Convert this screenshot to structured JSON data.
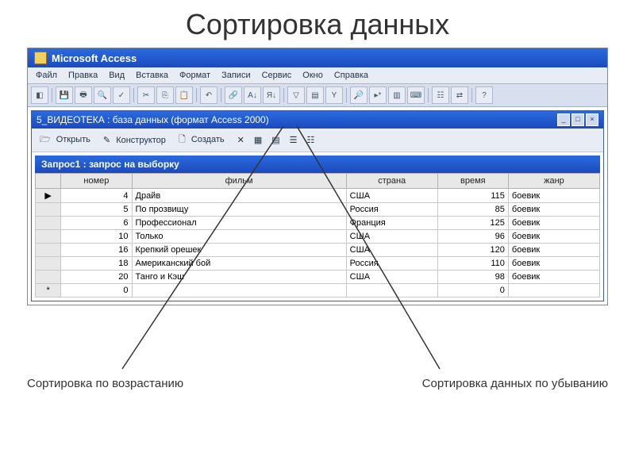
{
  "slide": {
    "title": "Сортировка данных"
  },
  "titlebar": {
    "app": "Microsoft Access"
  },
  "menu": {
    "items": [
      "Файл",
      "Правка",
      "Вид",
      "Вставка",
      "Формат",
      "Записи",
      "Сервис",
      "Окно",
      "Справка"
    ]
  },
  "toolbar": {
    "icons": [
      "view",
      "save",
      "print",
      "search",
      "preview",
      "spell",
      "cut",
      "copy",
      "paste",
      "undo",
      "link",
      "sort-asc",
      "sort-desc",
      "filter-sel",
      "filter-form",
      "filter-toggle",
      "find",
      "new-obj",
      "db-win",
      "code",
      "props",
      "rel",
      "help"
    ]
  },
  "dbwin": {
    "title": "5_ВИДЕОТЕКА : база данных (формат Access 2000)",
    "buttons": {
      "open": "Открыть",
      "design": "Конструктор",
      "create": "Создать"
    }
  },
  "qwin": {
    "title": "Запрос1 : запрос на выборку"
  },
  "headers": [
    "",
    "номер",
    "фильм",
    "страна",
    "время",
    "жанр"
  ],
  "rows": [
    {
      "sel": "▶",
      "n": "4",
      "film": "Драйв",
      "country": "США",
      "t": "115",
      "g": "боевик"
    },
    {
      "sel": "",
      "n": "5",
      "film": "По прозвищу",
      "country": "Россия",
      "t": "85",
      "g": "боевик"
    },
    {
      "sel": "",
      "n": "6",
      "film": "Профессионал",
      "country": "Франция",
      "t": "125",
      "g": "боевик"
    },
    {
      "sel": "",
      "n": "10",
      "film": "Только",
      "country": "США",
      "t": "96",
      "g": "боевик"
    },
    {
      "sel": "",
      "n": "16",
      "film": "Крепкий орешек",
      "country": "США",
      "t": "120",
      "g": "боевик"
    },
    {
      "sel": "",
      "n": "18",
      "film": "Американский бой",
      "country": "Россия",
      "t": "110",
      "g": "боевик"
    },
    {
      "sel": "",
      "n": "20",
      "film": "Танго и Кэш",
      "country": "США",
      "t": "98",
      "g": "боевик"
    },
    {
      "sel": "*",
      "n": "0",
      "film": "",
      "country": "",
      "t": "0",
      "g": ""
    }
  ],
  "callouts": {
    "asc": "Сортировка по возрастанию",
    "desc": "Сортировка данных по убыванию"
  }
}
